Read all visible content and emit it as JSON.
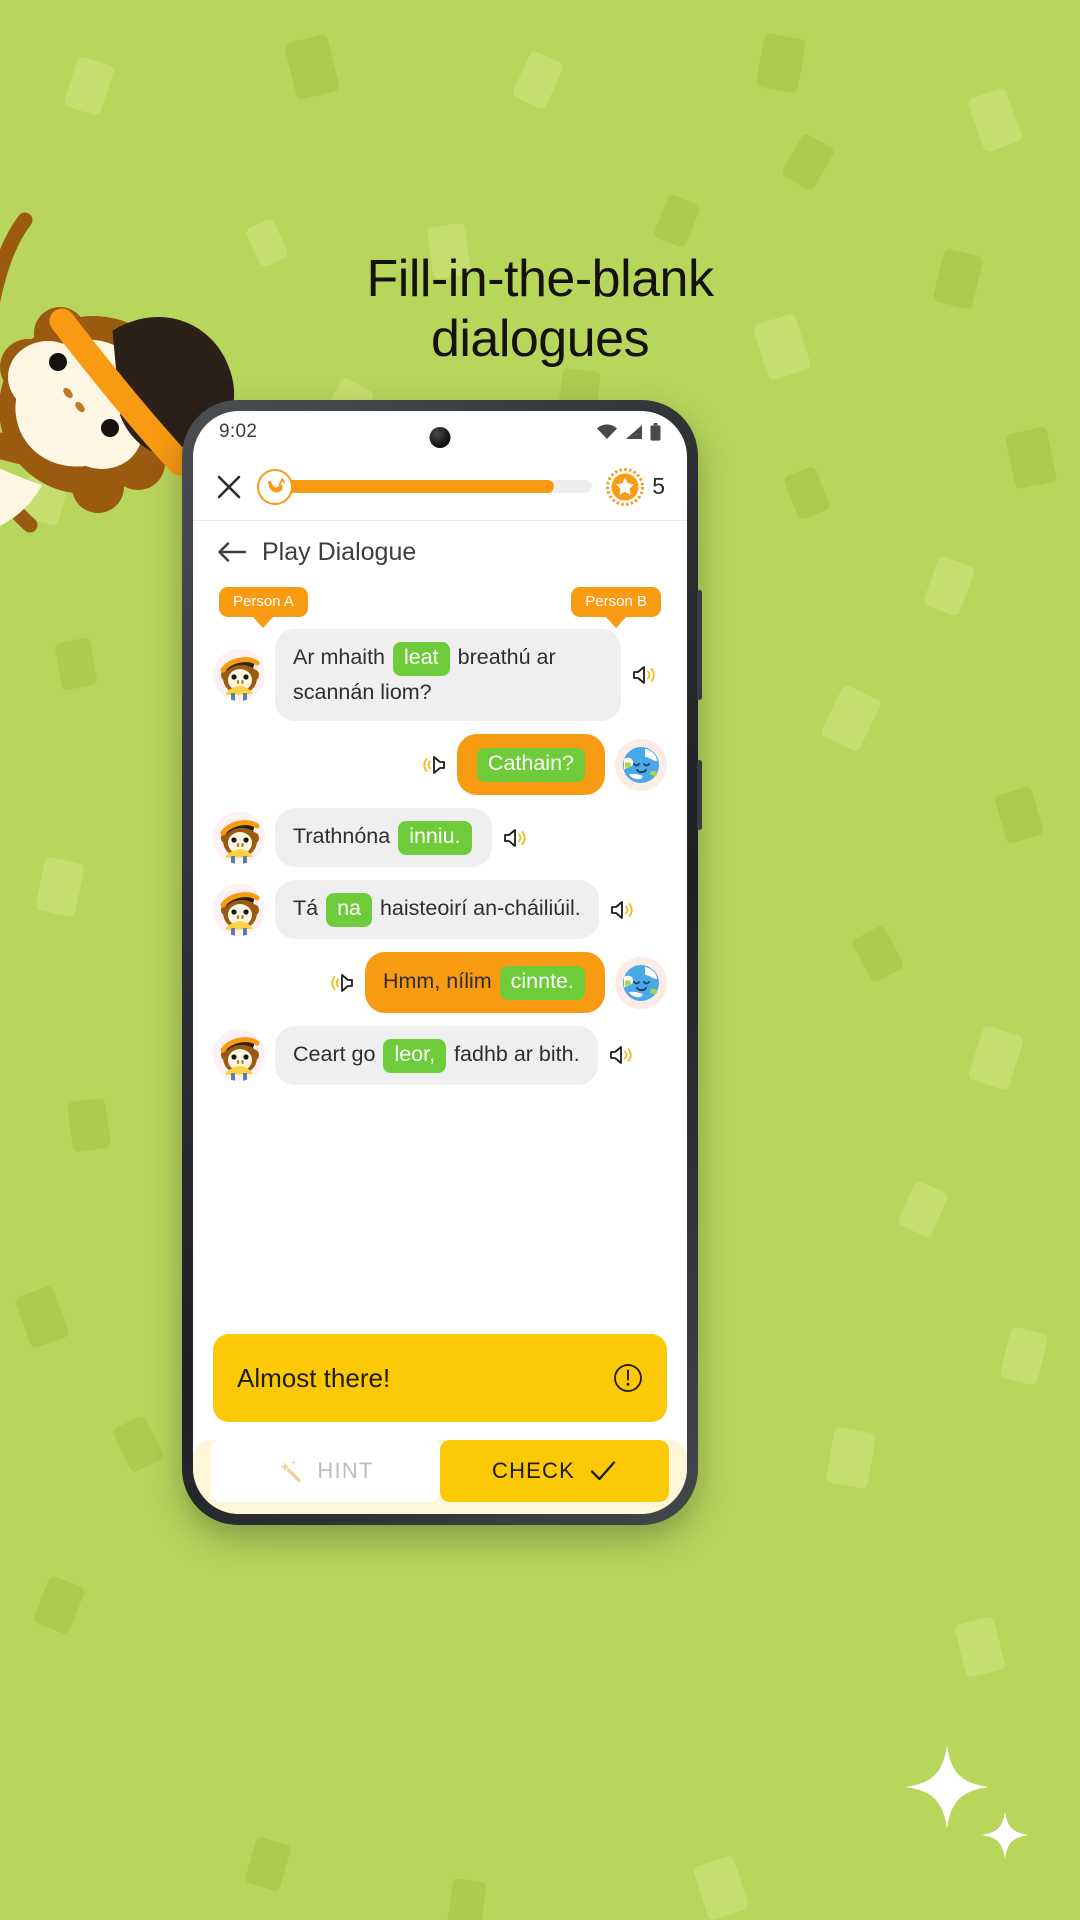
{
  "promo": {
    "headline_line1": "Fill-in-the-blank",
    "headline_line2": "dialogues",
    "background_color": "#b8d65c",
    "mascot": "monkey-mascot",
    "sparkle": "sparkles-decoration"
  },
  "statusbar": {
    "time": "9:02",
    "icons": [
      "wifi-icon",
      "cellular-signal-icon",
      "battery-icon"
    ]
  },
  "header": {
    "close_label": "×",
    "progress_percent": 88,
    "progress_color": "#f89a12",
    "badge_icon": "banana-icon",
    "coin_icon": "star-coin-icon",
    "coin_count": "5"
  },
  "title": {
    "back_icon": "back-arrow-icon",
    "text": "Play Dialogue"
  },
  "speakers": {
    "left_label": "Person A",
    "right_label": "Person B",
    "tag_color": "#f89a12"
  },
  "messages": [
    {
      "speaker": "A",
      "side": "left",
      "avatar": "monkey-avatar",
      "bubble_color": "#efefef",
      "parts": [
        {
          "type": "text",
          "value": "Ar mhaith "
        },
        {
          "type": "blank",
          "value": "leat"
        },
        {
          "type": "text",
          "value": " breathú ar scannán liom?"
        }
      ],
      "audio_icon": "speaker-icon"
    },
    {
      "speaker": "B",
      "side": "right",
      "avatar": "globe-avatar",
      "bubble_color": "#f89a12",
      "parts": [
        {
          "type": "blank",
          "value": "Cathain?"
        }
      ],
      "audio_icon": "speaker-play-icon"
    },
    {
      "speaker": "A",
      "side": "left",
      "avatar": "monkey-avatar",
      "bubble_color": "#efefef",
      "parts": [
        {
          "type": "text",
          "value": "Trathnóna "
        },
        {
          "type": "blank",
          "value": "inniu."
        }
      ],
      "audio_icon": "speaker-icon"
    },
    {
      "speaker": "A",
      "side": "left",
      "avatar": "monkey-avatar",
      "bubble_color": "#efefef",
      "parts": [
        {
          "type": "text",
          "value": "Tá "
        },
        {
          "type": "blank",
          "value": "na"
        },
        {
          "type": "text",
          "value": " haisteoirí an-cháiliúil."
        }
      ],
      "audio_icon": "speaker-icon"
    },
    {
      "speaker": "B",
      "side": "right",
      "avatar": "globe-avatar",
      "bubble_color": "#f89a12",
      "parts": [
        {
          "type": "text",
          "value": "Hmm, nílim "
        },
        {
          "type": "blank",
          "value": "cinnte."
        }
      ],
      "audio_icon": "speaker-play-icon"
    },
    {
      "speaker": "A",
      "side": "left",
      "avatar": "monkey-avatar",
      "bubble_color": "#efefef",
      "parts": [
        {
          "type": "text",
          "value": "Ceart go "
        },
        {
          "type": "blank",
          "value": "leor,"
        },
        {
          "type": "text",
          "value": " fadhb ar bith."
        }
      ],
      "audio_icon": "speaker-icon"
    }
  ],
  "feedback": {
    "text": "Almost there!",
    "icon": "info-exclamation-icon",
    "background": "#fbc905"
  },
  "actions": {
    "hint_label": "HINT",
    "hint_icon": "magic-wand-icon",
    "check_label": "CHECK",
    "check_icon": "checkmark-icon",
    "check_background": "#fbc905"
  },
  "blank_chip_color": "#6ecc3a"
}
